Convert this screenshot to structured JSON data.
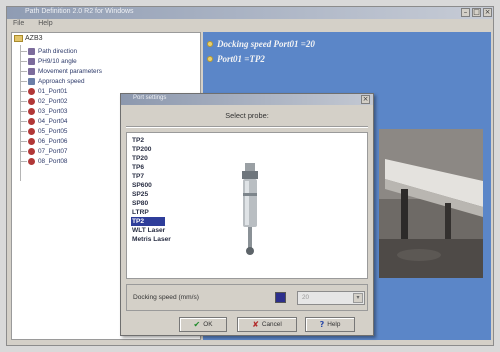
{
  "window": {
    "title": "Path Definition 2.0 R2 for Windows",
    "minimize": "–",
    "maximize": "□",
    "close": "×"
  },
  "menu": [
    "File",
    "Help"
  ],
  "tree": {
    "root": "AZB3",
    "items": [
      {
        "label": "Path direction",
        "icon": "gear"
      },
      {
        "label": "PH9/10 angle",
        "icon": "gear"
      },
      {
        "label": "Movement parameters",
        "icon": "gear"
      },
      {
        "label": "Approach speed",
        "icon": "pin"
      },
      {
        "label": "01_Port01",
        "icon": "red"
      },
      {
        "label": "02_Port02",
        "icon": "red"
      },
      {
        "label": "03_Port03",
        "icon": "red"
      },
      {
        "label": "04_Port04",
        "icon": "red"
      },
      {
        "label": "05_Port05",
        "icon": "red"
      },
      {
        "label": "06_Port06",
        "icon": "red"
      },
      {
        "label": "07_Port07",
        "icon": "red"
      },
      {
        "label": "08_Port08",
        "icon": "red"
      }
    ]
  },
  "viewport": {
    "line1": "Docking speed Port01 =20",
    "line2": "Port01 =TP2"
  },
  "dialog": {
    "title": "Port settings",
    "close": "×",
    "heading": "Select probe:",
    "probes": [
      "TP2",
      "TP200",
      "TP20",
      "TP6",
      "TP7",
      "SP600",
      "SP25",
      "SP80",
      "LTRP",
      "TP2",
      "WLT Laser",
      "Metris Laser"
    ],
    "selected_probe_index": 9,
    "speed_label": "Docking speed (mm/s)",
    "speed_value": "20",
    "swatch_color": "#2d2f8c",
    "combo_arrow": "▾",
    "buttons": {
      "ok": {
        "icon": "✔",
        "label": "OK"
      },
      "cancel": {
        "icon": "✘",
        "label": "Cancel"
      },
      "help": {
        "icon": "?",
        "label": "Help"
      }
    }
  }
}
